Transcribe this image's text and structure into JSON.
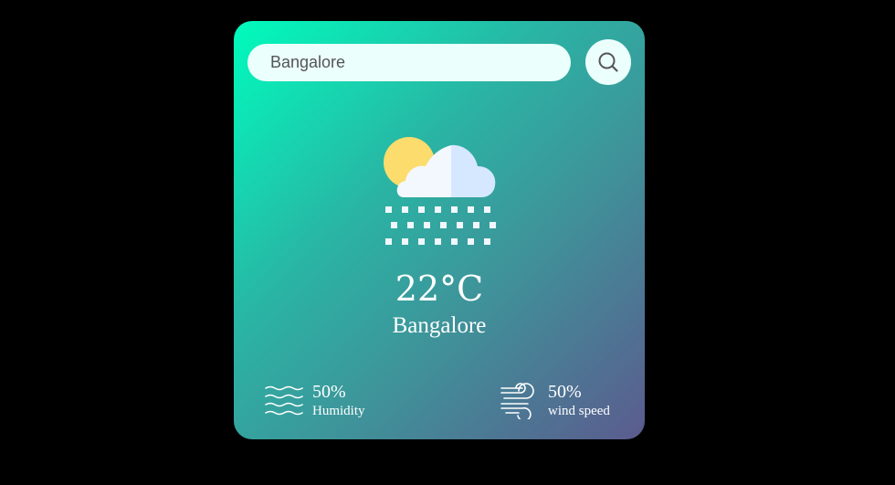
{
  "search": {
    "value": "Bangalore",
    "button_icon": "search-icon"
  },
  "weather": {
    "icon": "snow-cloud-sun-icon",
    "temperature": "22°C",
    "city": "Bangalore"
  },
  "stats": {
    "humidity": {
      "icon": "humidity-waves-icon",
      "value": "50%",
      "label": "Humidity"
    },
    "wind": {
      "icon": "wind-icon",
      "value": "50%",
      "label": "wind speed"
    }
  },
  "colors": {
    "page_background": "#000000",
    "card_gradient_start": "#00fcbd",
    "card_gradient_end": "#5b5b8e",
    "input_background": "#ebfffc",
    "text": "#ffffff"
  }
}
